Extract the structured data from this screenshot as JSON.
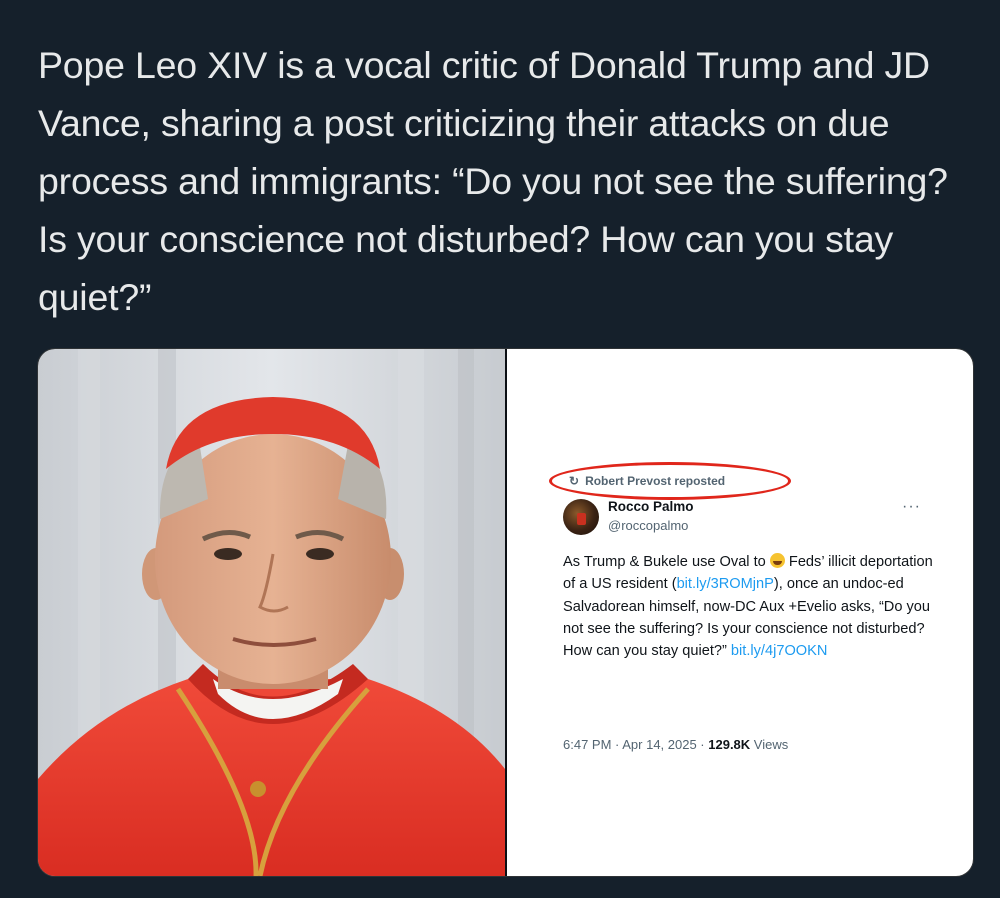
{
  "headline": "Pope Leo XIV is a vocal critic of Donald Trump and JD Vance, sharing a post criticizing their attacks on due process and immigrants: “Do you not see the suffering? Is your conscience not disturbed? How can you stay quiet?”",
  "tweet": {
    "repost_label": "Robert Prevost reposted",
    "author_name": "Rocco Palmo",
    "author_handle": "@roccopalmo",
    "more": "···",
    "body": {
      "part1": "As Trump & Bukele use Oval to ",
      "part2": " Feds’ illicit deportation of a US resident (",
      "link1": "bit.ly/3ROMjnP",
      "part3": "), once an undoc-ed Salvadorean himself, now-DC Aux +Evelio asks, “Do you not see the suffering? Is your conscience not disturbed? How can you stay quiet?” ",
      "link2": "bit.ly/4j7OOKN"
    },
    "time": "6:47 PM · Apr 14, 2025 · ",
    "views_count": "129.8K",
    "views_label": " Views"
  },
  "icons": {
    "repost": "↻",
    "emoji": "rolling-on-floor-laughing-emoji"
  },
  "colors": {
    "background": "#15202b",
    "headline_text": "#e7e9ea",
    "link": "#1d9bf0",
    "highlight_oval": "#e0261b",
    "cardinal_red": "#e8372a"
  }
}
